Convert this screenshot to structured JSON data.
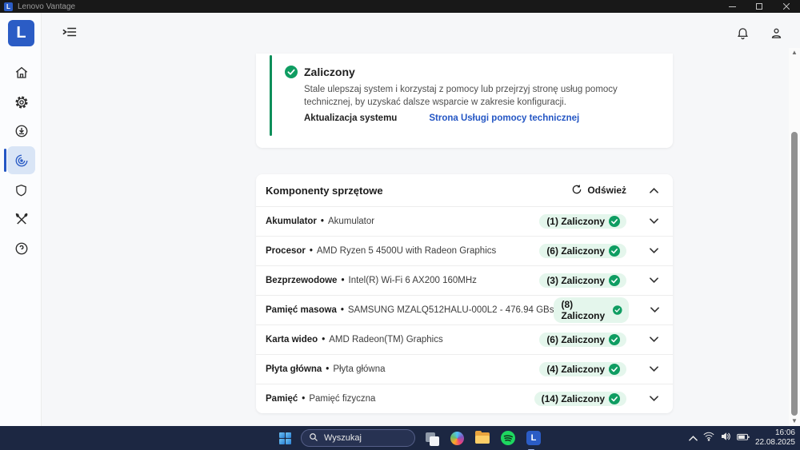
{
  "window": {
    "title": "Lenovo Vantage",
    "logo_letter": "L"
  },
  "colors": {
    "accent_blue": "#2b5cc5",
    "status_green": "#0f9d62",
    "badge_background": "#e4f6ec",
    "link_blue": "#2456c4",
    "taskbar_background": "#1c2742"
  },
  "sidebar": {
    "logo_letter": "L",
    "items": [
      {
        "icon": "home-icon",
        "active": false
      },
      {
        "icon": "gear-icon",
        "active": false
      },
      {
        "icon": "update-download-icon",
        "active": false
      },
      {
        "icon": "hardware-scan-icon",
        "active": true
      },
      {
        "icon": "security-shield-icon",
        "active": false
      },
      {
        "icon": "tools-icon",
        "active": false
      },
      {
        "icon": "help-icon",
        "active": false
      }
    ]
  },
  "status_card": {
    "title": "Zaliczony",
    "description": "Stale ulepszaj system i korzystaj z pomocy lub przejrzyj stronę usług pomocy technicznej, by uzyskać dalsze wsparcie w zakresie konfiguracji.",
    "link_primary": "Aktualizacja systemu",
    "link_secondary": "Strona Usługi pomocy technicznej"
  },
  "hardware": {
    "title": "Komponenty sprzętowe",
    "refresh_label": "Odśwież",
    "bullet": "•",
    "rows": [
      {
        "name": "Akumulator",
        "desc": "Akumulator",
        "badge": "(1) Zaliczony"
      },
      {
        "name": "Procesor",
        "desc": "AMD Ryzen 5 4500U with Radeon Graphics",
        "badge": "(6) Zaliczony"
      },
      {
        "name": "Bezprzewodowe",
        "desc": "Intel(R) Wi-Fi 6 AX200 160MHz",
        "badge": "(3) Zaliczony"
      },
      {
        "name": "Pamięć masowa",
        "desc": "SAMSUNG MZALQ512HALU-000L2 - 476.94 GBs",
        "badge": "(8) Zaliczony"
      },
      {
        "name": "Karta wideo",
        "desc": "AMD Radeon(TM) Graphics",
        "badge": "(6) Zaliczony"
      },
      {
        "name": "Płyta główna",
        "desc": "Płyta główna",
        "badge": "(4) Zaliczony"
      },
      {
        "name": "Pamięć",
        "desc": "Pamięć fizyczna",
        "badge": "(14) Zaliczony"
      }
    ]
  },
  "scrollbar": {
    "up_glyph": "▲",
    "down_glyph": "▼"
  },
  "taskbar": {
    "search_placeholder": "Wyszukaj",
    "vantage_letter": "L",
    "clock": {
      "time": "16:06",
      "date": "22.08.2025"
    }
  }
}
